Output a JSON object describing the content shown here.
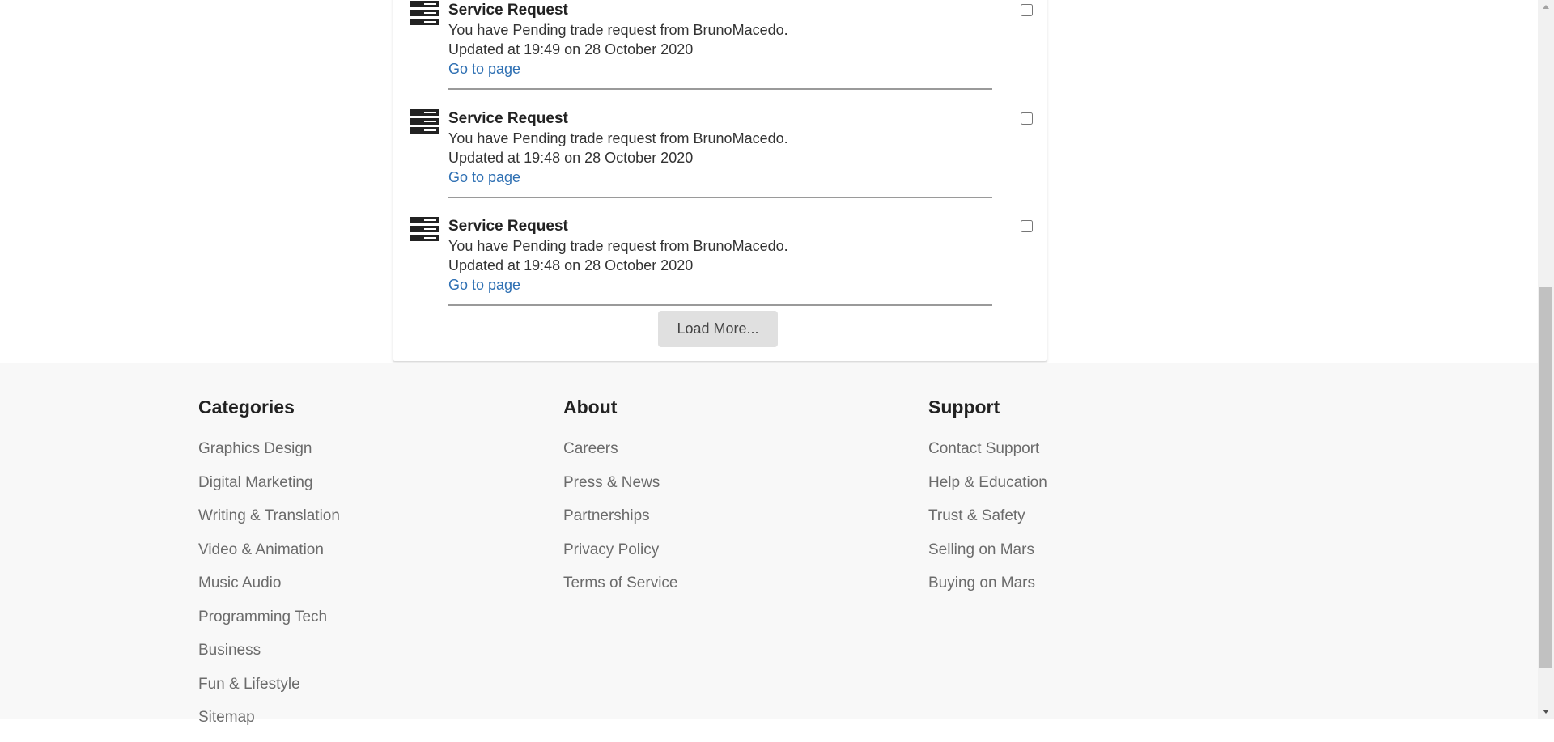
{
  "notifications": [
    {
      "title": "Service Request",
      "message": "You have Pending trade request from BrunoMacedo.",
      "updated": "Updated at 19:49 on 28 October 2020",
      "link": "Go to page"
    },
    {
      "title": "Service Request",
      "message": "You have Pending trade request from BrunoMacedo.",
      "updated": "Updated at 19:48 on 28 October 2020",
      "link": "Go to page"
    },
    {
      "title": "Service Request",
      "message": "You have Pending trade request from BrunoMacedo.",
      "updated": "Updated at 19:48 on 28 October 2020",
      "link": "Go to page"
    }
  ],
  "load_more_label": "Load More...",
  "footer": {
    "categories": {
      "title": "Categories",
      "items": [
        "Graphics Design",
        "Digital Marketing",
        "Writing & Translation",
        "Video & Animation",
        "Music Audio",
        "Programming Tech",
        "Business",
        "Fun & Lifestyle",
        "Sitemap"
      ]
    },
    "about": {
      "title": "About",
      "items": [
        "Careers",
        "Press & News",
        "Partnerships",
        "Privacy Policy",
        "Terms of Service"
      ]
    },
    "support": {
      "title": "Support",
      "items": [
        "Contact Support",
        "Help & Education",
        "Trust & Safety",
        "Selling on Mars",
        "Buying on Mars"
      ]
    }
  },
  "colors": {
    "link": "#2f70b3",
    "footer_bg": "#f8f8f8",
    "button_bg": "#e0e0e0"
  },
  "icons": {
    "notification": "server-icon",
    "scroll_up": "scroll-up-arrow-icon",
    "scroll_down": "scroll-down-arrow-icon"
  }
}
